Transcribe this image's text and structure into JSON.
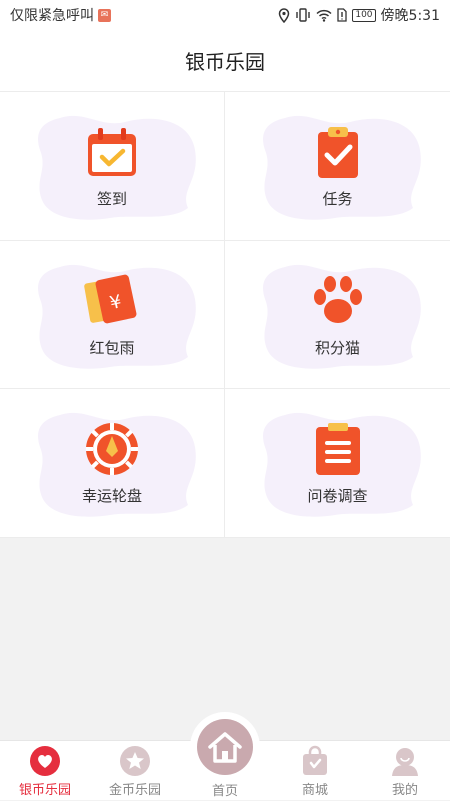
{
  "status_bar": {
    "carrier": "仅限紧急呼叫",
    "time_prefix": "傍晚",
    "time": "5:31",
    "battery": "100"
  },
  "header": {
    "title": "银币乐园"
  },
  "grid": {
    "items": [
      {
        "label": "签到",
        "icon": "calendar-check-icon"
      },
      {
        "label": "任务",
        "icon": "clipboard-check-icon"
      },
      {
        "label": "红包雨",
        "icon": "red-envelope-icon"
      },
      {
        "label": "积分猫",
        "icon": "paw-icon"
      },
      {
        "label": "幸运轮盘",
        "icon": "lucky-wheel-icon"
      },
      {
        "label": "问卷调查",
        "icon": "survey-clipboard-icon"
      }
    ]
  },
  "tabbar": {
    "items": [
      {
        "label": "银币乐园",
        "icon": "heart-icon",
        "active": true
      },
      {
        "label": "金币乐园",
        "icon": "star-icon",
        "active": false
      },
      {
        "label": "首页",
        "icon": "home-icon",
        "active": false
      },
      {
        "label": "商城",
        "icon": "shopping-bag-icon",
        "active": false
      },
      {
        "label": "我的",
        "icon": "user-icon",
        "active": false
      }
    ]
  },
  "colors": {
    "accent": "#e52e3e",
    "icon_orange": "#f0532a",
    "blob": "#f5f0fb",
    "home": "#c9a9ae",
    "inactive_tab": "#d9c6c9"
  }
}
